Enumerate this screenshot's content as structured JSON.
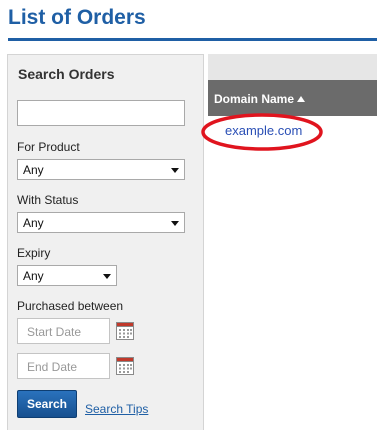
{
  "page": {
    "title": "List of Orders"
  },
  "search_panel": {
    "heading": "Search Orders",
    "search_value": "",
    "for_product": {
      "label": "For Product",
      "selected": "Any"
    },
    "with_status": {
      "label": "With Status",
      "selected": "Any"
    },
    "expiry": {
      "label": "Expiry",
      "selected": "Any"
    },
    "purchased_between": {
      "label": "Purchased between",
      "start_placeholder": "Start Date",
      "end_placeholder": "End Date"
    },
    "search_button": "Search",
    "search_tips": "Search Tips"
  },
  "results": {
    "column_header": "Domain Name",
    "sort": "ascending",
    "rows": [
      {
        "domain": "example.com"
      }
    ]
  },
  "colors": {
    "brand_blue": "#1f5fa5",
    "link_blue": "#2a4fb5",
    "header_gray": "#6b6b6b",
    "highlight_red": "#e0141e"
  }
}
